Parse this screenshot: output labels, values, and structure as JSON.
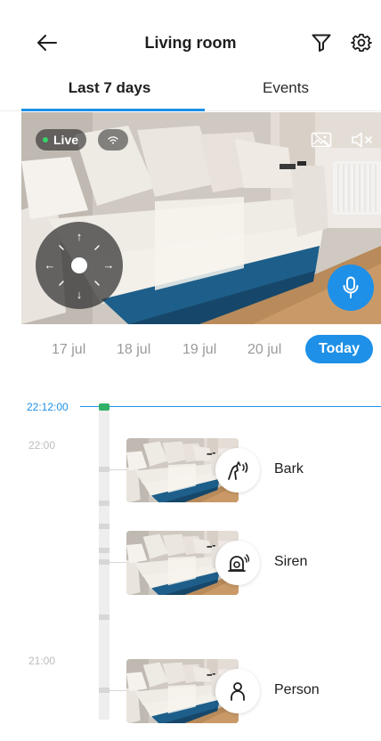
{
  "header": {
    "title": "Living room",
    "back_icon": "arrow-left-icon",
    "filter_icon": "filter-icon",
    "settings_icon": "gear-icon"
  },
  "tabs": [
    {
      "label": "Last 7 days",
      "active": true
    },
    {
      "label": "Events",
      "active": false
    }
  ],
  "camera": {
    "live_label": "Live",
    "status_icons": [
      "wifi-icon",
      "image-off-icon",
      "speaker-muted-icon"
    ],
    "ptz_icons": [
      "arrow-up-icon",
      "arrow-down-icon",
      "arrow-left-icon",
      "arrow-right-icon"
    ],
    "mic_icon": "microphone-icon"
  },
  "dates": {
    "items": [
      "17 jul",
      "18 jul",
      "19 jul",
      "20 jul"
    ],
    "selected": "Today"
  },
  "timeline": {
    "current_time": "22:12:00",
    "hour_labels": [
      "22:00",
      "21:00"
    ]
  },
  "events": [
    {
      "label": "Bark",
      "icon": "bark-icon"
    },
    {
      "label": "Siren",
      "icon": "siren-icon"
    },
    {
      "label": "Person",
      "icon": "person-icon"
    }
  ],
  "colors": {
    "accent": "#1e90e8",
    "live_dot": "#3ad36b",
    "now_handle": "#2fb066"
  }
}
